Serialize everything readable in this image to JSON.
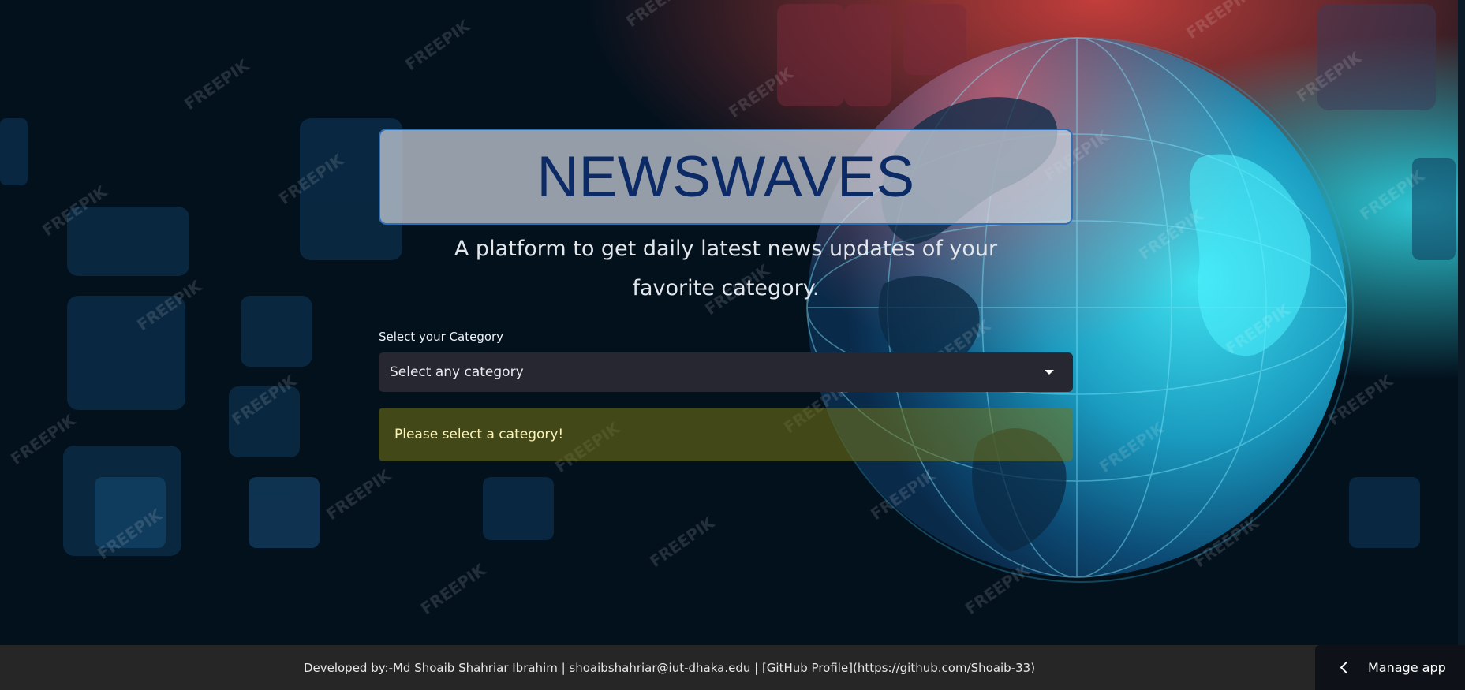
{
  "header": {
    "title": "NEWSWAVES",
    "subtitle": "A platform to get daily latest news updates of your favorite category."
  },
  "category_select": {
    "label": "Select your Category",
    "value": "Select any category"
  },
  "alert": {
    "message": "Please select a category!"
  },
  "footer": {
    "text": "Developed by:-Md Shoaib Shahriar Ibrahim | shoaibshahriar@iut-dhaka.edu | [GitHub Profile](https://github.com/Shoaib-33)"
  },
  "manage_app": {
    "label": "Manage app"
  },
  "icons": {
    "select_caret": "caret-down-icon",
    "manage_chevron": "chevron-left-icon"
  },
  "colors": {
    "title_text": "#0c2a66",
    "title_border": "#2f6fb3",
    "select_bg": "#262730",
    "warning_text": "#fbf4b8",
    "footer_bg": "#262626",
    "manage_bg": "#0e1117"
  }
}
